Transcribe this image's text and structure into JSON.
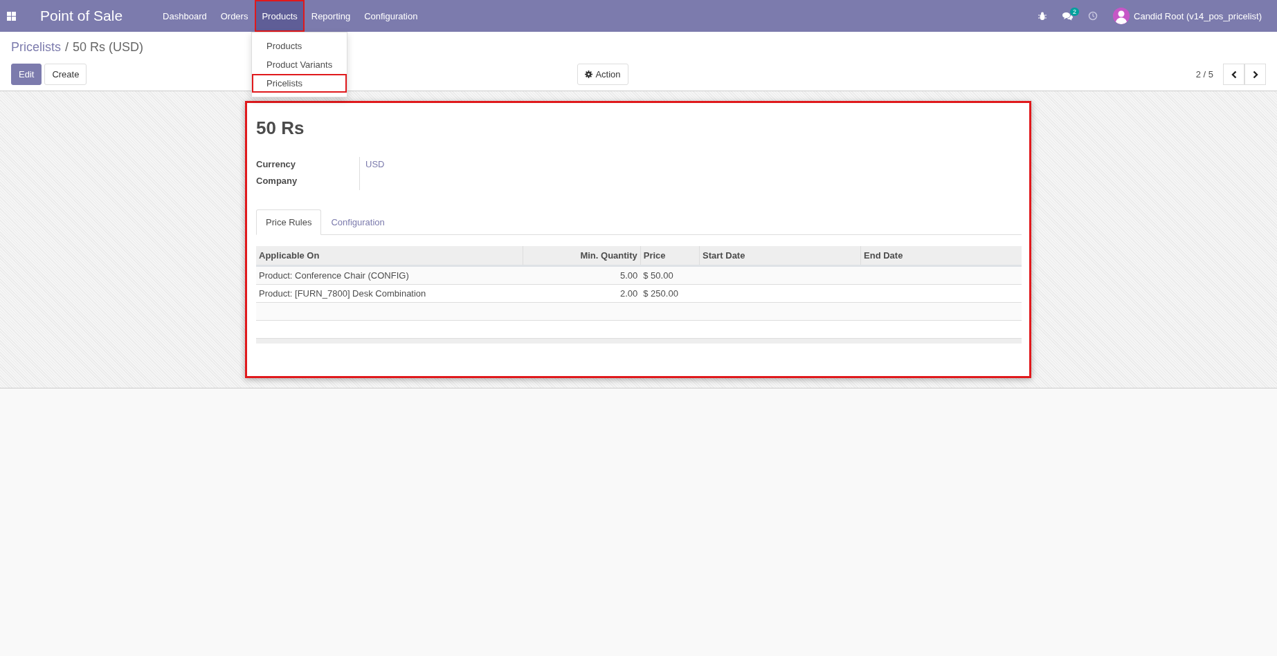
{
  "navbar": {
    "app_title": "Point of Sale",
    "menu": [
      {
        "label": "Dashboard",
        "selected": false,
        "highlighted": false
      },
      {
        "label": "Orders",
        "selected": false,
        "highlighted": false
      },
      {
        "label": "Products",
        "selected": true,
        "highlighted": true
      },
      {
        "label": "Reporting",
        "selected": false,
        "highlighted": false
      },
      {
        "label": "Configuration",
        "selected": false,
        "highlighted": false
      }
    ],
    "message_count": "2",
    "user": "Candid Root (v14_pos_pricelist)"
  },
  "dropdown": {
    "items": [
      {
        "label": "Products",
        "highlighted": false
      },
      {
        "label": "Product Variants",
        "highlighted": false
      },
      {
        "label": "Pricelists",
        "highlighted": true
      }
    ]
  },
  "breadcrumb": {
    "parent": "Pricelists",
    "separator": "/",
    "current": "50 Rs (USD)"
  },
  "buttons": [
    {
      "label": "Edit",
      "kind": "primary"
    },
    {
      "label": "Create",
      "kind": "secondary"
    }
  ],
  "action_button": "Action",
  "pager": "2 / 5",
  "form": {
    "highlighted": true,
    "title": "50 Rs",
    "fields": [
      {
        "label": "Currency",
        "value": "USD"
      },
      {
        "label": "Company"
      }
    ],
    "tabs": [
      {
        "label": "Price Rules",
        "selected": true
      },
      {
        "label": "Configuration",
        "selected": false
      }
    ],
    "table": {
      "columns": [
        {
          "label": "Applicable On"
        },
        {
          "label": "Min. Quantity"
        },
        {
          "label": "Price"
        },
        {
          "label": "Start Date"
        },
        {
          "label": "End Date"
        }
      ],
      "rows": [
        [
          "Product: Conference Chair (CONFIG)",
          "5.00",
          "$ 50.00"
        ],
        [
          "Product: [FURN_7800] Desk Combination",
          "2.00",
          "$ 250.00"
        ]
      ]
    }
  }
}
